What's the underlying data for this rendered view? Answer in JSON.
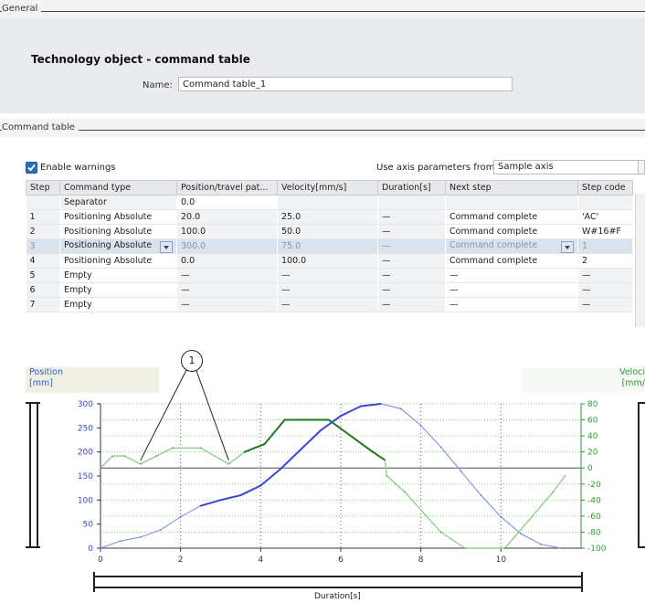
{
  "general": {
    "section_label": "General"
  },
  "tech": {
    "title": "Technology object - command table",
    "name_label": "Name:",
    "name_value": "Command table_1"
  },
  "cmdsec": {
    "section_label": "Command table"
  },
  "options": {
    "enable_warnings_label": "Enable warnings",
    "enable_warnings_checked": true,
    "axis_params_label": "Use axis parameters from:",
    "axis_params_value": "Sample axis"
  },
  "table": {
    "columns": [
      "Step",
      "Command type",
      "Position/travel pat...",
      "Velocity[mm/s]",
      "Duration[s]",
      "Next step",
      "Step code"
    ],
    "rows": [
      [
        "",
        "Separator",
        "0.0",
        "",
        "",
        "",
        ""
      ],
      [
        "1",
        "Positioning Absolute",
        "20.0",
        "25.0",
        "—",
        "Command complete",
        "'AC'"
      ],
      [
        "2",
        "Positioning Absolute",
        "100.0",
        "50.0",
        "—",
        "Command complete",
        "W#16#F"
      ],
      [
        "3",
        "Positioning Absolute",
        "300.0",
        "75.0",
        "—",
        "Command complete",
        "1"
      ],
      [
        "4",
        "Positioning Absolute",
        "0.0",
        "100.0",
        "—",
        "Command complete",
        "2"
      ],
      [
        "5",
        "Empty",
        "—",
        "—",
        "—",
        "—",
        "—"
      ],
      [
        "6",
        "Empty",
        "—",
        "—",
        "—",
        "—",
        "—"
      ],
      [
        "7",
        "Empty",
        "—",
        "—",
        "—",
        "—",
        "—"
      ]
    ]
  },
  "callout": {
    "number": "1"
  },
  "colors": {
    "position": "#3a46d6",
    "velocity": "#2fa52f",
    "position_light": "#8f98e6",
    "velocity_light": "#8fd08f"
  },
  "chart_data": {
    "type": "line",
    "xlabel": "Duration[s]",
    "ylabel": "Position\n[mm]",
    "y2label": "Veloci\n[mm/",
    "xlim": [
      0,
      12
    ],
    "ylim": [
      0,
      300
    ],
    "y2lim": [
      -100,
      80
    ],
    "x_ticks": [
      "0",
      "2",
      "4",
      "6",
      "8",
      "10"
    ],
    "y_ticks": [
      "0",
      "50",
      "100",
      "150",
      "200",
      "250",
      "300"
    ],
    "y2_ticks": [
      "80",
      "60",
      "40",
      "20",
      "0",
      "-20",
      "-40",
      "-60",
      "-80",
      "-100"
    ],
    "grid": true,
    "series": [
      {
        "axis": "left",
        "x": [
          0,
          0.5,
          1,
          1.5,
          2,
          2.5,
          3,
          3.5,
          4,
          4.5,
          5,
          5.5,
          6,
          6.5,
          7,
          7.5,
          8,
          8.5,
          9,
          9.5,
          10,
          10.5,
          11,
          11.5
        ],
        "values": [
          0,
          15,
          23,
          38,
          65,
          88,
          100,
          110,
          130,
          165,
          205,
          245,
          275,
          295,
          300,
          290,
          255,
          210,
          160,
          110,
          65,
          30,
          8,
          0
        ]
      },
      {
        "axis": "right",
        "x": [
          0,
          0.3,
          0.6,
          1,
          1.4,
          1.8,
          2.5,
          3.2,
          3.6,
          4.1,
          4.6,
          5.7,
          6.8,
          7.1,
          7.15,
          7.6,
          8.5,
          9.1,
          10.1,
          11.3,
          11.6
        ],
        "values": [
          0,
          15,
          15,
          5,
          15,
          25,
          25,
          5,
          20,
          30,
          60,
          60,
          20,
          10,
          -10,
          -30,
          -80,
          -100,
          -100,
          -30,
          -10
        ]
      }
    ]
  }
}
